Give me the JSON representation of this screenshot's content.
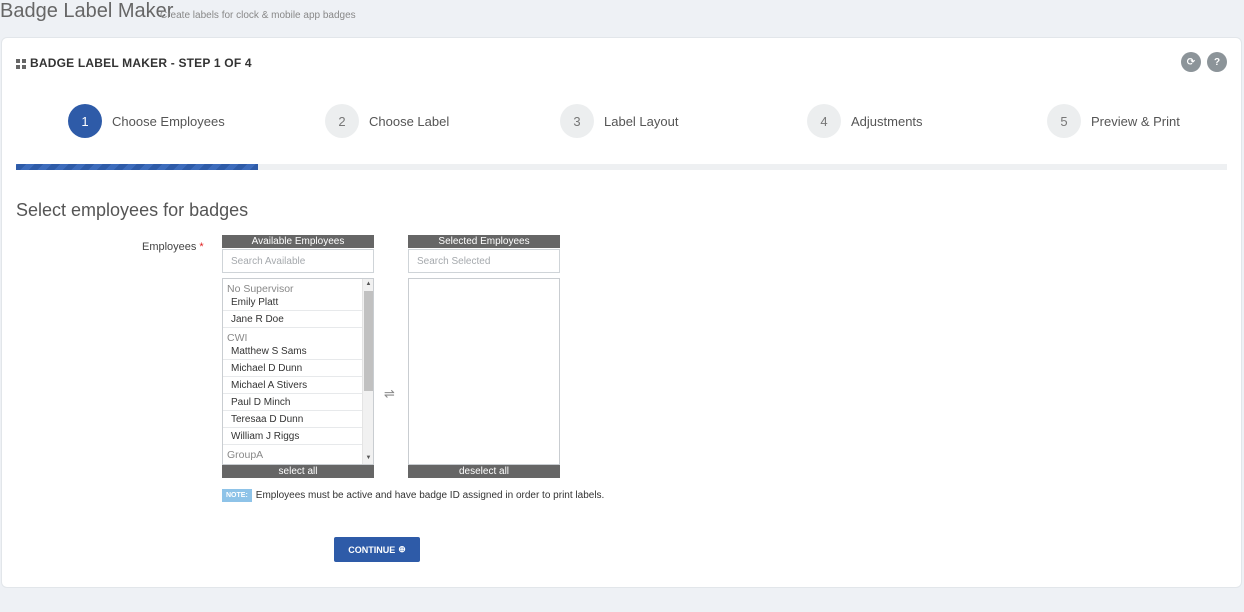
{
  "page": {
    "title": "Badge Label Maker",
    "subtitle": "Create labels for clock & mobile app badges"
  },
  "portlet": {
    "title": "BADGE LABEL MAKER - STEP 1 OF 4",
    "tools": [
      {
        "icon": "refresh-icon",
        "glyph": "⟳"
      },
      {
        "icon": "help-icon",
        "glyph": "?"
      }
    ]
  },
  "steps": [
    {
      "number": "1",
      "label": "Choose Employees",
      "active": true
    },
    {
      "number": "2",
      "label": "Choose Label",
      "active": false
    },
    {
      "number": "3",
      "label": "Label Layout",
      "active": false
    },
    {
      "number": "4",
      "label": "Adjustments",
      "active": false
    },
    {
      "number": "5",
      "label": "Preview & Print",
      "active": false
    }
  ],
  "progress": {
    "fraction": 0.2
  },
  "form": {
    "section_title": "Select employees for badges",
    "employees_label": "Employees",
    "required_mark": "*",
    "available": {
      "header": "Available Employees",
      "search_placeholder": "Search Available",
      "footer": "select all",
      "groups": [
        {
          "name": "No Supervisor",
          "employees": [
            "Emily Platt",
            "Jane R Doe"
          ]
        },
        {
          "name": "CWI",
          "employees": [
            "Matthew S Sams",
            "Michael D Dunn",
            "Michael A Stivers",
            "Paul D Minch",
            "Teresaa D Dunn",
            "William J Riggs"
          ]
        },
        {
          "name": "GroupA",
          "employees": []
        }
      ]
    },
    "selected": {
      "header": "Selected Employees",
      "search_placeholder": "Search Selected",
      "footer": "deselect all"
    },
    "swap_glyph": "⇌",
    "note_badge": "NOTE:",
    "note_text": "Employees must be active and have badge ID assigned in order to print labels.",
    "continue_label": "CONTINUE",
    "continue_glyph": "⊕"
  },
  "colors": {
    "accent": "#2e5ba8",
    "header_bg": "#666666",
    "note_badge": "#8ec3e8"
  }
}
